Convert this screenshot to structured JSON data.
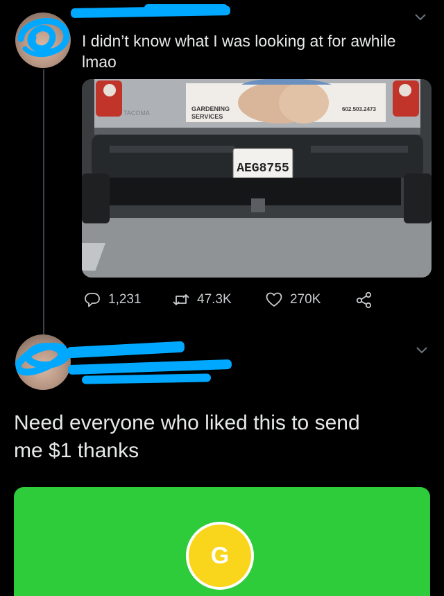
{
  "tweet1": {
    "text": "I didn’t know what I was looking at for awhile\nlmao",
    "image": {
      "sign_company": "GARDENING\nSERVICES",
      "sign_phone": "602.503.2473",
      "truck_badge": "TACOMA",
      "license_plate": "AEG8755"
    },
    "actions": {
      "replies": "1,231",
      "retweets": "47.3K",
      "likes": "270K"
    }
  },
  "tweet2": {
    "text": "Need everyone who liked this to send\nme $1 thanks"
  },
  "card": {
    "logo_letter": "G",
    "bg_color": "#2ecc3b",
    "logo_color": "#f9d51b"
  },
  "icons": {
    "reply": "reply-icon",
    "retweet": "retweet-icon",
    "like": "heart-icon",
    "share": "share-icon",
    "menu": "chevron-down-icon"
  },
  "colors": {
    "background": "#000000",
    "redaction": "#00a8ff",
    "text": "#e7e9ea",
    "muted": "#c9ccd0"
  }
}
